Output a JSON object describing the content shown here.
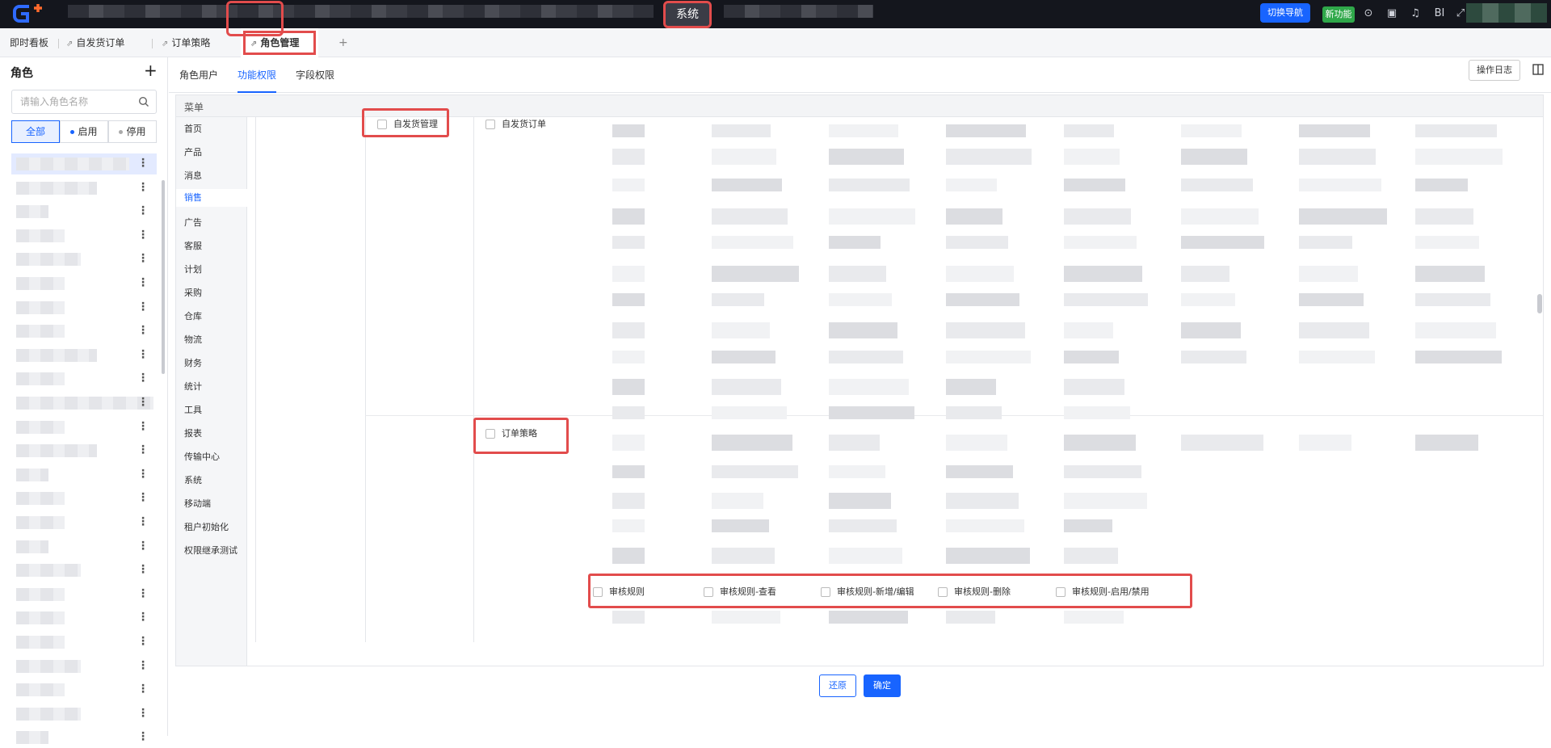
{
  "topbar": {
    "system_tab": "系统",
    "nav_button": "切换导航",
    "new_button": "新功能",
    "bi_label": "BI"
  },
  "tabs": [
    {
      "label": "即时看板"
    },
    {
      "label": "自发货订单"
    },
    {
      "label": "订单策略"
    },
    {
      "label": "角色管理"
    }
  ],
  "tab_add": "+",
  "roles": {
    "title": "角色",
    "add": "+",
    "search_placeholder": "请输入角色名称",
    "filters": [
      "全部",
      "启用",
      "停用"
    ],
    "filter_active": "全部"
  },
  "subtabs": [
    "角色用户",
    "功能权限",
    "字段权限"
  ],
  "subtab_active": "功能权限",
  "op_log_button": "操作日志",
  "permissions": {
    "header": "菜单",
    "menu": [
      "首页",
      "产品",
      "消息",
      "销售",
      "广告",
      "客服",
      "计划",
      "采购",
      "仓库",
      "物流",
      "财务",
      "统计",
      "工具",
      "报表",
      "传输中心",
      "系统",
      "移动端",
      "租户初始化",
      "权限继承测试"
    ],
    "menu_active": "销售",
    "level2": "自发货管理",
    "level3_a": "自发货订单",
    "level3_b": "订单策略",
    "audit": {
      "name": "审核规则",
      "ops": [
        "审核规则-查看",
        "审核规则-新增/编辑",
        "审核规则-删除",
        "审核规则-启用/禁用"
      ]
    }
  },
  "footer": {
    "restore": "还原",
    "confirm": "确定"
  },
  "colors": {
    "primary": "#1864ff",
    "highlight": "#e24c4c",
    "topbar": "#14161d",
    "new_badge": "#2fa84a"
  }
}
